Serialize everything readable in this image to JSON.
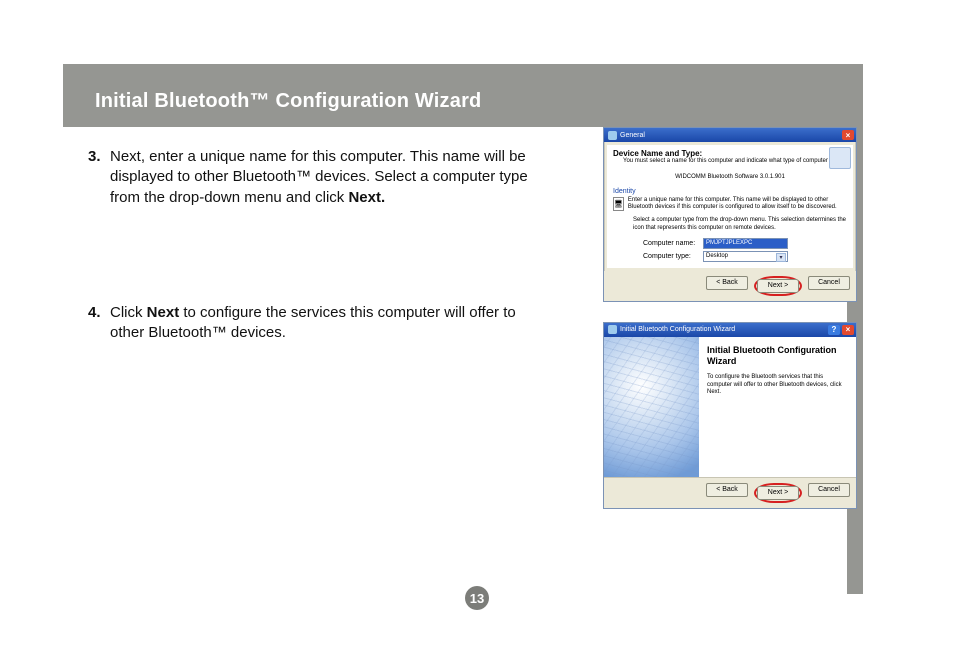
{
  "page": {
    "title": "Initial Bluetooth™ Configuration Wizard",
    "number": "13"
  },
  "steps": {
    "s3": {
      "num": "3.",
      "pre": "Next, enter a unique name for this computer. This name will be displayed to other Bluetooth™ devices. Select a computer type from the drop-down menu and click ",
      "bold": "Next."
    },
    "s4": {
      "num": "4.",
      "pre": "Click ",
      "bold": "Next",
      "post": " to configure the services this computer will offer to other Bluetooth™ devices."
    }
  },
  "dlg1": {
    "title": "General",
    "close": "×",
    "head": "Device Name and Type:",
    "headsub": "You must select a name for this computer and indicate what type of computer it is.",
    "version": "WIDCOMM Bluetooth Software 3.0.1.901",
    "section": "Identity",
    "id_text": "Enter a unique name for this computer. This name will be displayed to other Bluetooth devices if this computer is configured to allow itself to be discovered.",
    "sel_text": "Select a computer type from the drop-down menu. This selection determines the icon that represents this computer on remote devices.",
    "name_label": "Computer name:",
    "name_value": "PMJPTJPLEXPC",
    "type_label": "Computer type:",
    "type_value": "Desktop",
    "btn_back": "< Back",
    "btn_next": "Next >",
    "btn_cancel": "Cancel"
  },
  "dlg2": {
    "title": "Initial Bluetooth Configuration Wizard",
    "help": "?",
    "close": "×",
    "wtitle": "Initial Bluetooth Configuration Wizard",
    "wdesc": "To configure the Bluetooth services that this computer will offer to other Bluetooth devices, click Next.",
    "btn_back": "< Back",
    "btn_next": "Next >",
    "btn_cancel": "Cancel"
  }
}
